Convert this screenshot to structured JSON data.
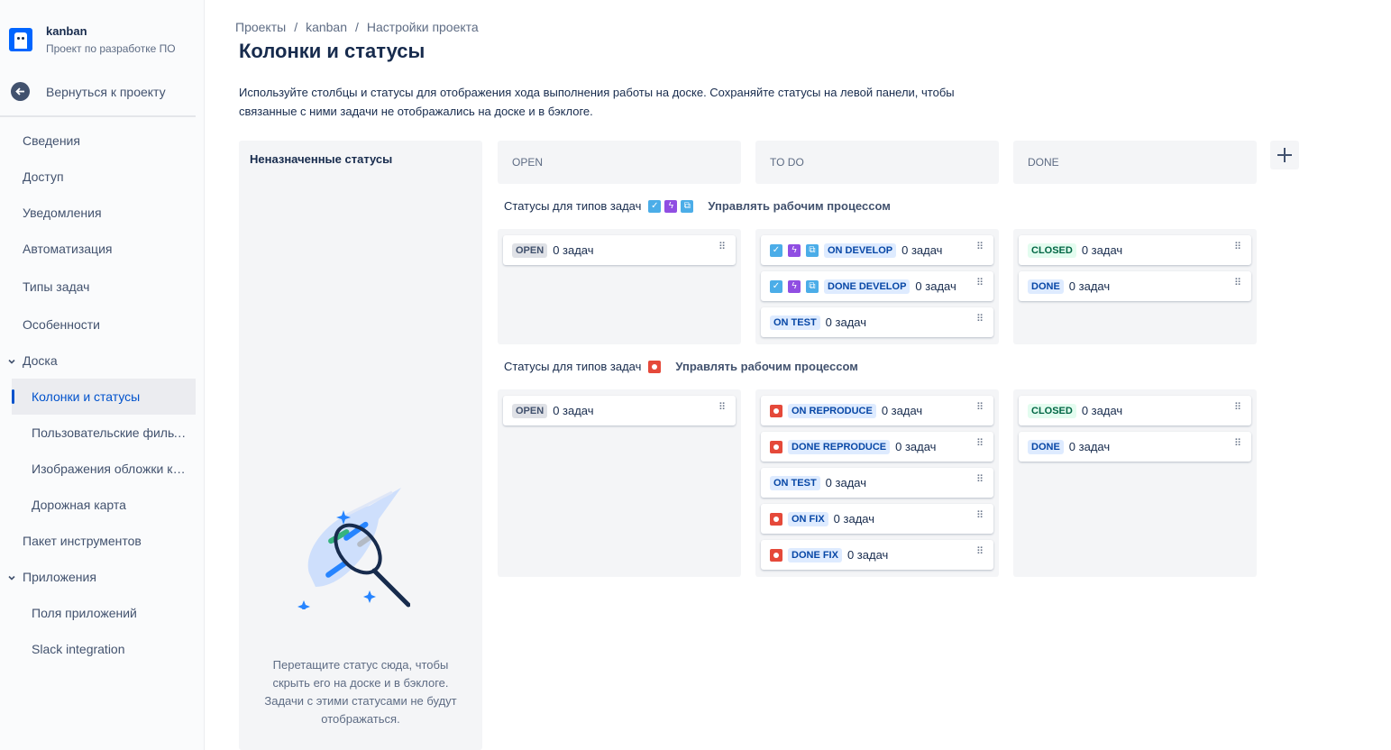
{
  "project": {
    "name": "kanban",
    "subtitle": "Проект по разработке ПО"
  },
  "back_label": "Вернуться к проекту",
  "nav": {
    "overview": "Сведения",
    "access": "Доступ",
    "notifications": "Уведомления",
    "automation": "Автоматизация",
    "issue_types": "Типы задач",
    "features": "Особенности",
    "board": "Доска",
    "columns": "Колонки и статусы",
    "filters": "Пользовательские фильтры",
    "card_covers": "Изображения обложки карточек",
    "roadmap": "Дорожная карта",
    "toolchain": "Пакет инструментов",
    "apps": "Приложения",
    "app_fields": "Поля приложений",
    "slack": "Slack integration"
  },
  "breadcrumbs": [
    "Проекты",
    "kanban",
    "Настройки проекта"
  ],
  "page_title": "Колонки и статусы",
  "description": "Используйте столбцы и статусы для отображения хода выполнения работы на доске. Сохраняйте статусы на левой панели, чтобы связанные с ними задачи не отображались на доске и в бэклоге.",
  "unassigned": {
    "title": "Неназначенные статусы",
    "hint": "Перетащите статус сюда, чтобы скрыть его на доске и в бэклоге. Задачи с этими статусами не будут отображаться."
  },
  "columns": [
    "OPEN",
    "TO DO",
    "DONE"
  ],
  "add_column_icon": "plus-icon",
  "workflow_label": "Статусы для типов задач",
  "manage_workflow": "Управлять рабочим процессом",
  "zero": "0 задач",
  "groups": [
    {
      "type_icons": [
        "task-icon",
        "epic-icon",
        "subtask-icon"
      ],
      "open": [
        {
          "status": "OPEN",
          "count": "0 задач"
        }
      ],
      "todo": [
        {
          "status": "ON DEVELOP",
          "count": "0 задач"
        },
        {
          "status": "DONE DEVELOP",
          "count": "0 задач"
        },
        {
          "status": "ON TEST",
          "count": "0 задач"
        }
      ],
      "done": [
        {
          "status": "CLOSED",
          "count": "0 задач"
        },
        {
          "status": "DONE",
          "count": "0 задач"
        }
      ]
    },
    {
      "type_icons": [
        "bug-icon"
      ],
      "open": [
        {
          "status": "OPEN",
          "count": "0 задач"
        }
      ],
      "todo": [
        {
          "status": "ON REPRODUCE",
          "count": "0 задач"
        },
        {
          "status": "DONE REPRODUCE",
          "count": "0 задач"
        },
        {
          "status": "ON TEST",
          "count": "0 задач"
        },
        {
          "status": "ON FIX",
          "count": "0 задач"
        },
        {
          "status": "DONE FIX",
          "count": "0 задач"
        }
      ],
      "done": [
        {
          "status": "CLOSED",
          "count": "0 задач"
        },
        {
          "status": "DONE",
          "count": "0 задач"
        }
      ]
    }
  ]
}
